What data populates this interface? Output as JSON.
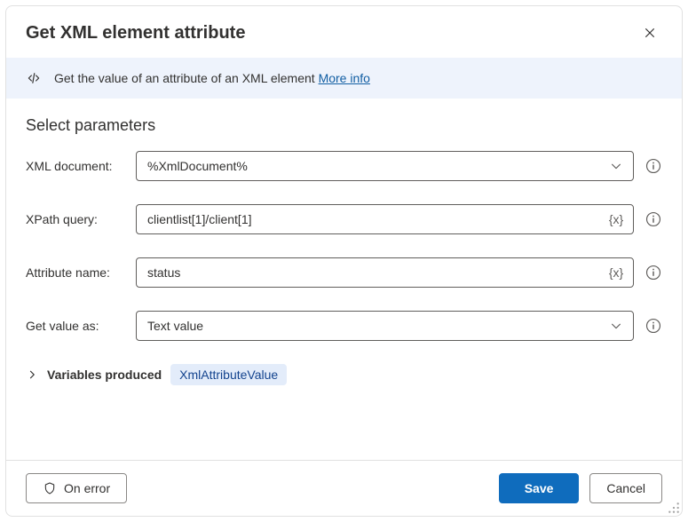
{
  "header": {
    "title": "Get XML element attribute"
  },
  "infoBar": {
    "description": "Get the value of an attribute of an XML element",
    "moreInfo": "More info"
  },
  "section": {
    "title": "Select parameters"
  },
  "params": {
    "xmlDocument": {
      "label": "XML document:",
      "value": "%XmlDocument%"
    },
    "xpathQuery": {
      "label": "XPath query:",
      "value": "clientlist[1]/client[1]",
      "fxBadge": "{x}"
    },
    "attrName": {
      "label": "Attribute name:",
      "value": "status",
      "fxBadge": "{x}"
    },
    "getValueAs": {
      "label": "Get value as:",
      "value": "Text value"
    }
  },
  "variablesProduced": {
    "label": "Variables produced",
    "chip": "XmlAttributeValue"
  },
  "footer": {
    "onError": "On error",
    "save": "Save",
    "cancel": "Cancel"
  }
}
